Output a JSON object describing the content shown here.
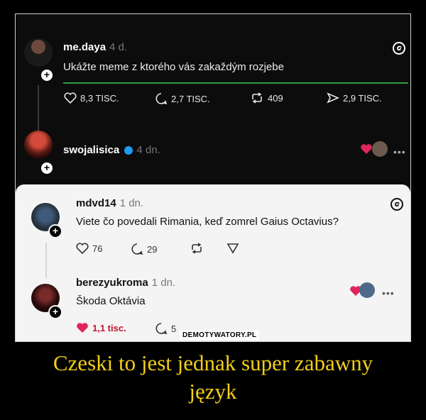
{
  "post1": {
    "username": "me.daya",
    "time": "4 d.",
    "text": "Ukážte meme z ktorého vás zakaždým rozjebe",
    "likes": "8,3 TISC.",
    "comments": "2,7 TISC.",
    "reposts": "409",
    "shares": "2,9 TISC."
  },
  "post2": {
    "username": "swojalisica",
    "time": "4 dn."
  },
  "post3": {
    "username": "mdvd14",
    "time": "1 dn.",
    "text": "Viete čo povedali Rimania, keď zomrel Gaius Octavius?",
    "likes": "76",
    "comments": "29"
  },
  "post4": {
    "username": "berezyukroma",
    "time": "1 dn.",
    "text": "Škoda Oktávia",
    "likes": "1,1 tisc.",
    "comments": "5"
  },
  "watermark": "DEMOTYWATORY.PL",
  "caption_line1": "Czeski to jest jednak super zabawny",
  "caption_line2": "język",
  "colors": {
    "caption": "#f3ce19",
    "verified": "#1d9bf0",
    "heart": "#e0245e",
    "green_line": "#2e9e3c"
  },
  "icons": [
    "threads-logo-icon",
    "heart-icon",
    "comment-icon",
    "repost-icon",
    "share-icon",
    "verified-badge-icon",
    "more-icon",
    "plus-icon"
  ]
}
